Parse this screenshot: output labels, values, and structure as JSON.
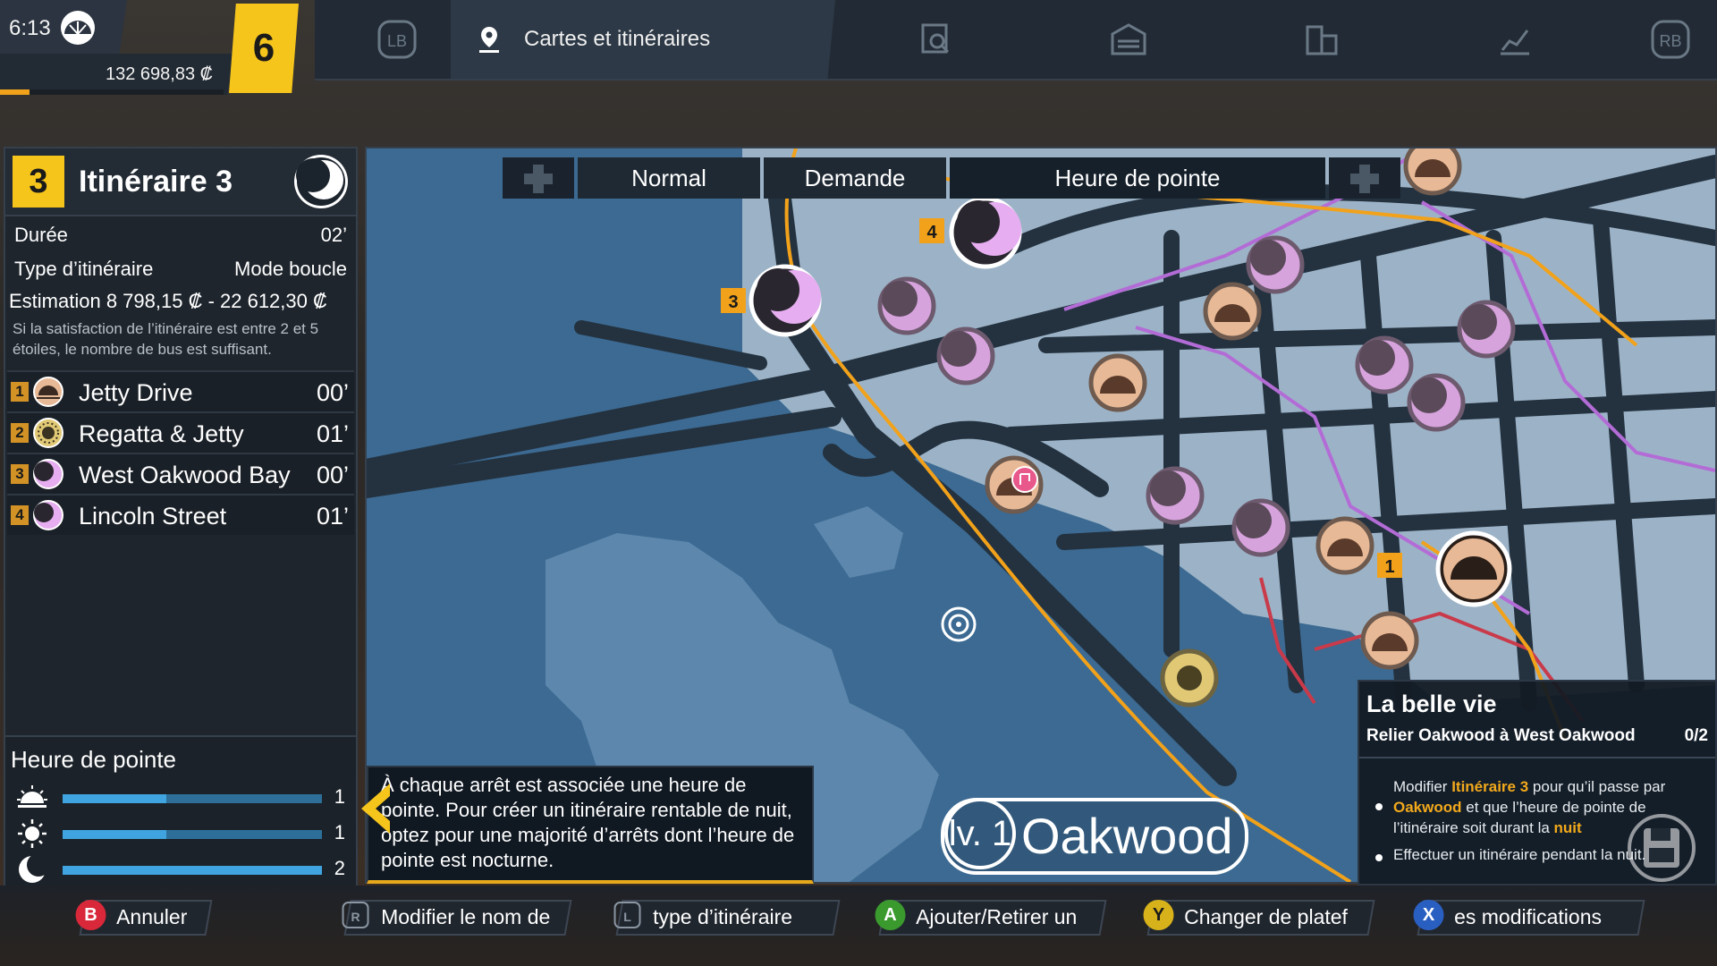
{
  "hud": {
    "time": "6:13",
    "money": "132 698,83 ₡",
    "level": "6",
    "xp_progress": 0.13
  },
  "nav": {
    "lb": "LB",
    "rb": "RB",
    "active_tab": "Cartes et itinéraires"
  },
  "route": {
    "number": "3",
    "name": "Itinéraire 3",
    "duration_label": "Durée",
    "duration_value": "02’",
    "type_label": "Type d’itinéraire",
    "type_value": "Mode boucle",
    "estimate": "Estimation 8 798,15 ₡ - 22 612,30 ₡",
    "note": "Si la satisfaction de l’itinéraire est entre 2 et 5 étoiles, le nombre de bus est suffisant.",
    "stops": [
      {
        "idx": "1",
        "name": "Jetty Drive",
        "time": "00’",
        "period": "dawn"
      },
      {
        "idx": "2",
        "name": "Regatta & Jetty",
        "time": "01’",
        "period": "day"
      },
      {
        "idx": "3",
        "name": "West Oakwood Bay",
        "time": "00’",
        "period": "night"
      },
      {
        "idx": "4",
        "name": "Lincoln Street",
        "time": "01’",
        "period": "night"
      }
    ]
  },
  "peak": {
    "title": "Heure de pointe",
    "rows": [
      {
        "period": "dawn",
        "value": "1",
        "fill": 0.4
      },
      {
        "period": "day",
        "value": "1",
        "fill": 0.4
      },
      {
        "period": "night",
        "value": "2",
        "fill": 1.0
      }
    ]
  },
  "map_tabs": {
    "normal": "Normal",
    "demand": "Demande",
    "peak": "Heure de pointe"
  },
  "map_markers": {
    "m1": "1",
    "m3": "3",
    "m4": "4"
  },
  "tip": {
    "text": "À chaque arrêt est associée une heure de pointe. Pour créer un itinéraire rentable de nuit, optez pour une majorité d’arrêts dont l’heure de pointe est nocturne."
  },
  "district": {
    "level": "lv. 1",
    "name": "Oakwood"
  },
  "mission": {
    "title": "La belle vie",
    "subtitle": "Relier Oakwood à West Oakwood",
    "count": "0/2",
    "obj1_a": "Modifier ",
    "obj1_route": "Itinéraire 3",
    "obj1_b": " pour qu’il passe par ",
    "obj1_place": "Oakwood",
    "obj1_c": " et que l’heure de pointe de l’itinéraire soit durant la ",
    "obj1_night": "nuit",
    "obj2": "Effectuer un itinéraire pendant la nuit."
  },
  "buttons": {
    "cancel_glyph": "B",
    "cancel": "Annuler",
    "rename": "Modifier le nom de",
    "route_type": "type d’itinéraire",
    "add_glyph": "A",
    "add_remove": "Ajouter/Retirer un",
    "platform_glyph": "Y",
    "platform": "Changer de platef",
    "save_glyph": "X",
    "save": "es modifications"
  },
  "colors": {
    "accent": "#f6c51c",
    "water": "#3c6a92",
    "land": "#9cb3c7",
    "road": "#243240",
    "route_line": "#f2a21a",
    "night": "#e6aef0",
    "dawn": "#e8b996"
  }
}
